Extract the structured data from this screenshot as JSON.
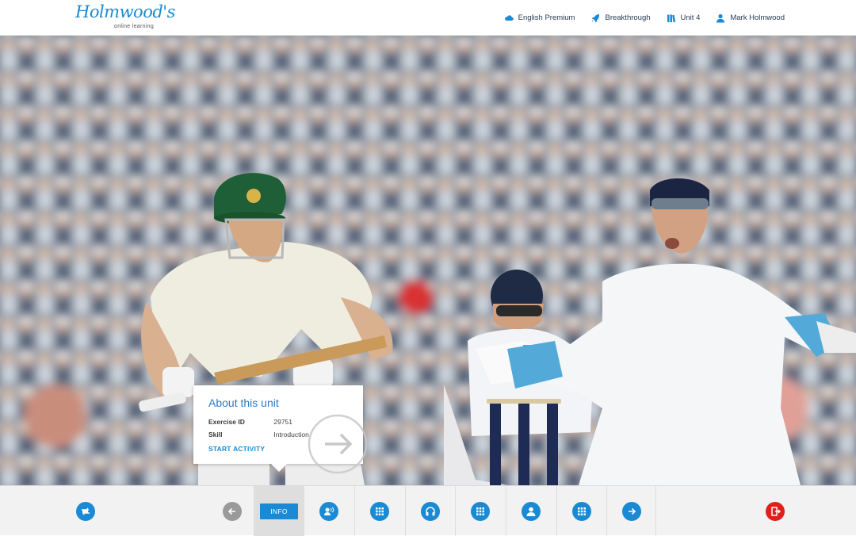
{
  "header": {
    "logo_text": "Holmwood's",
    "logo_subtext": "online learning",
    "nav": [
      {
        "label": "English Premium",
        "icon": "cloud-icon"
      },
      {
        "label": "Breakthrough",
        "icon": "rocket-icon"
      },
      {
        "label": "Unit 4",
        "icon": "books-icon"
      },
      {
        "label": "Mark Holmwood",
        "icon": "user-icon"
      }
    ]
  },
  "hero": {
    "image_subject": "cricket-match-photo"
  },
  "card": {
    "title": "About this unit",
    "rows": [
      {
        "key": "Exercise ID",
        "value": "29751"
      },
      {
        "key": "Skill",
        "value": "Introduction"
      }
    ],
    "action_label": "START ACTIVITY"
  },
  "bottombar": {
    "info_label": "INFO",
    "buttons": [
      {
        "name": "switch-course-icon"
      },
      {
        "name": "back-arrow-icon"
      },
      {
        "name": "speaking-icon"
      },
      {
        "name": "grid-icon"
      },
      {
        "name": "headphones-icon"
      },
      {
        "name": "grid-icon"
      },
      {
        "name": "person-icon"
      },
      {
        "name": "grid-icon"
      },
      {
        "name": "forward-arrow-icon"
      },
      {
        "name": "exit-icon"
      }
    ]
  },
  "colors": {
    "accent": "#1a8ad4",
    "exit": "#e0201b",
    "disabled": "#9a9a9a"
  }
}
